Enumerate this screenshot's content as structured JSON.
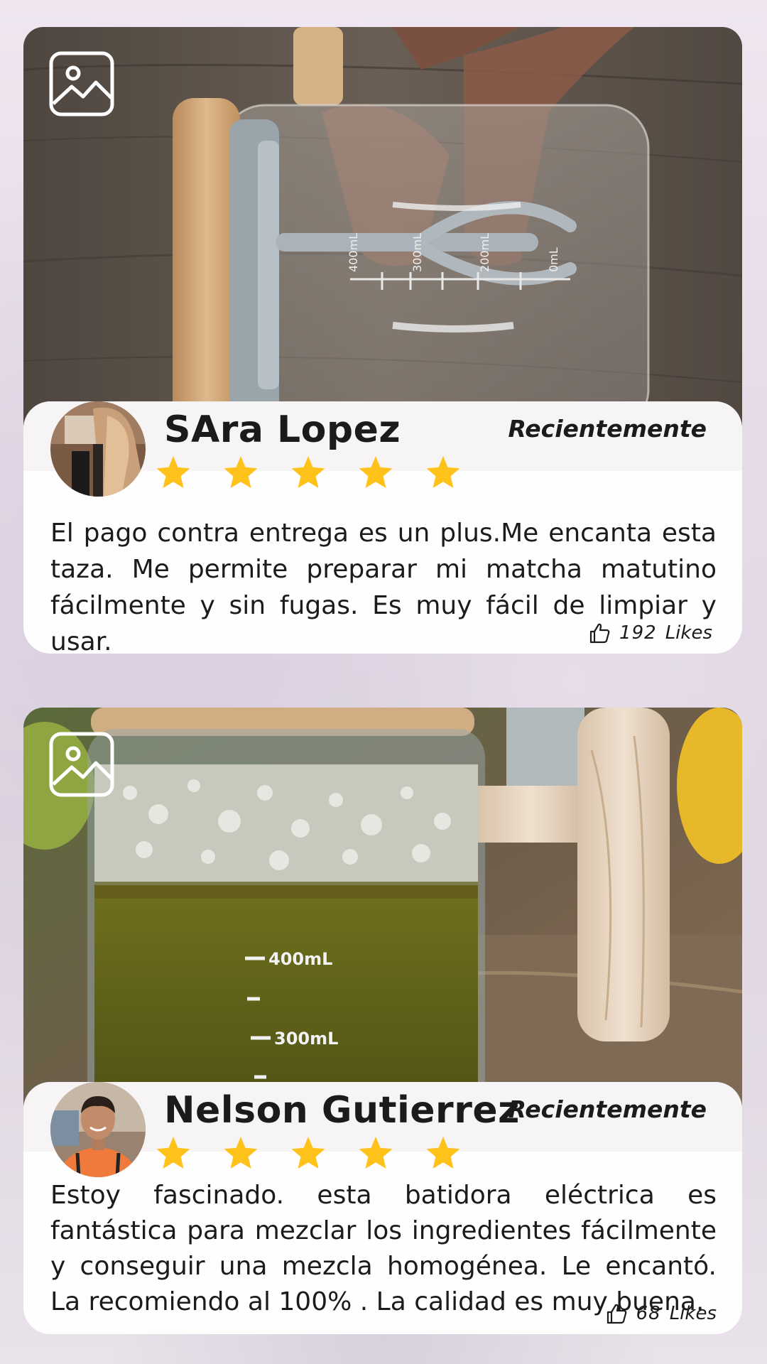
{
  "reviews": [
    {
      "reviewer_name": "SAra Lopez",
      "date_label": "Recientemente",
      "rating": 5,
      "review_text": "El pago contra entrega es un plus.Me encanta esta taza. Me permite preparar mi matcha matutino fácilmente y sin fugas. Es muy fácil de limpiar y usar.",
      "likes_count": "192",
      "likes_label": "Likes",
      "photo_icon": "image-icon",
      "like_icon": "thumbs-up-icon"
    },
    {
      "reviewer_name": "Nelson Gutierrez",
      "date_label": "Recientemente",
      "rating": 5,
      "review_text": "Estoy fascinado. esta batidora eléctrica es fantástica para mezclar los ingredientes fácilmente y conseguir una mezcla homogénea. Le encantó. La recomiendo al 100% . La calidad es muy buena.",
      "likes_count": "68",
      "likes_label": "Likes",
      "photo_icon": "image-icon",
      "like_icon": "thumbs-up-icon"
    }
  ],
  "photo_labels": {
    "photo1_marks": [
      "400mL",
      "300mL",
      "200mL",
      "0mL"
    ],
    "photo2_marks": [
      "400mL",
      "300mL"
    ]
  },
  "colors": {
    "star": "#FFC21A",
    "text": "#1B1B1B",
    "card_bg": "#FFFFFF"
  }
}
